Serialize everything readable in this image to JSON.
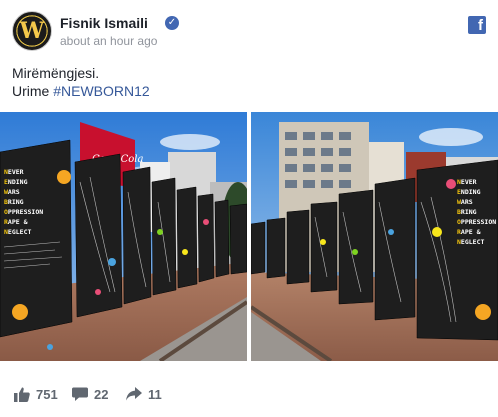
{
  "post": {
    "author": "Fisnik Ismaili",
    "avatar_letter": "W",
    "timestamp": "about an hour ago",
    "text_line1": "Mirëmëngjesi.",
    "text_line2_prefix": "Urime ",
    "hashtag": "#NEWBORN12",
    "brand_icon": "facebook-icon",
    "verified_icon": "verified-badge-icon"
  },
  "photos": [
    {
      "description_id": "left",
      "sign_letters": [
        "N",
        "E",
        "W",
        "B",
        "O",
        "R",
        "N"
      ],
      "acrostic": [
        "NEVER",
        "ENDING",
        "WARS",
        "BRING",
        "OPPRESSION",
        "RAPE &",
        "NEGLECT"
      ],
      "billboard": "Coca-Cola"
    },
    {
      "description_id": "right",
      "sign_letters": [
        "N",
        "E",
        "W",
        "B",
        "O",
        "R",
        "N"
      ],
      "acrostic": [
        "NEVER",
        "ENDING",
        "WARS",
        "BRING",
        "OPPRESSION",
        "RAPE &",
        "NEGLECT"
      ]
    }
  ],
  "stats": {
    "likes": "751",
    "comments": "22",
    "shares": "11"
  },
  "colors": {
    "link": "#365899",
    "brand": "#4267b2",
    "muted": "#90949c",
    "stat": "#606770"
  }
}
